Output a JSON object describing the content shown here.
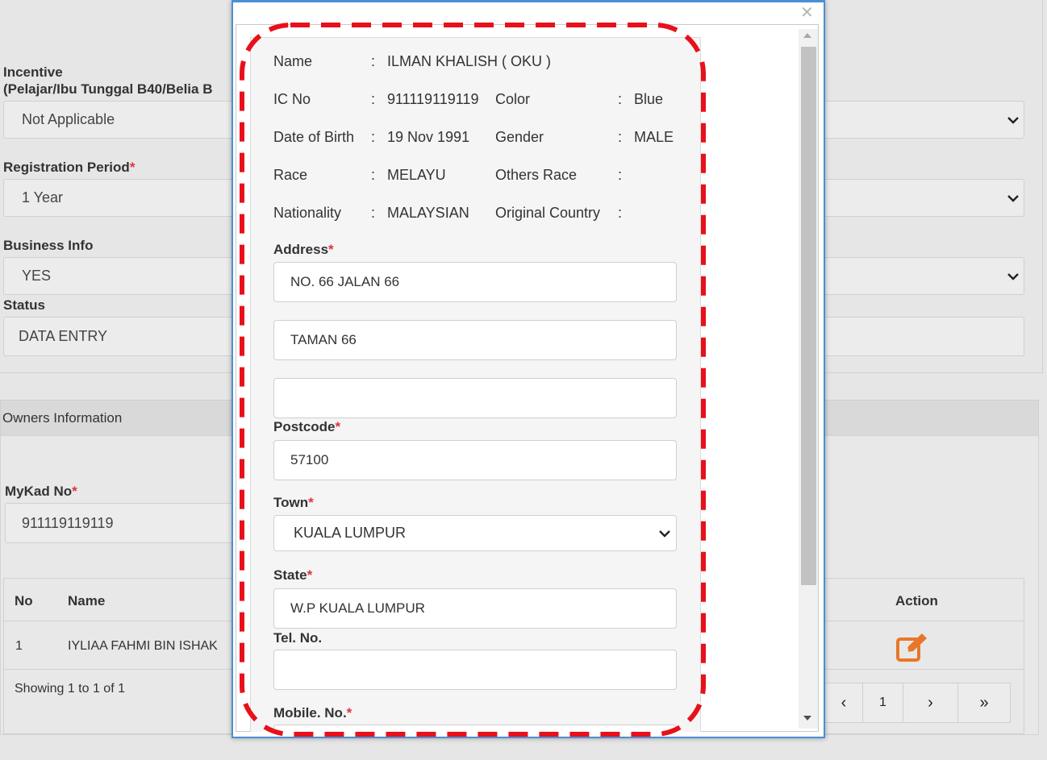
{
  "background": {
    "incentive_label": "Incentive",
    "incentive_sublabel": "(Pelajar/Ibu Tunggal B40/Belia B",
    "incentive_value": "Not Applicable",
    "registration_period_label": "Registration Period",
    "registration_period_value": "1 Year",
    "business_info_label": "Business Info",
    "business_info_value": "YES",
    "status_label": "Status",
    "status_value": "DATA ENTRY",
    "owners_header": "Owners Information",
    "mykad_label": "MyKad No",
    "mykad_value": "911119119119",
    "table": {
      "col_no": "No",
      "col_name": "Name",
      "col_action": "Action",
      "row_no": "1",
      "row_name": "IYLIAA FAHMI BIN ISHAK",
      "showing": "Showing 1 to 1 of 1"
    },
    "pager": {
      "prev": "‹",
      "page": "1",
      "next": "›",
      "last": "»"
    },
    "required_mark": "*"
  },
  "modal": {
    "close": "✕",
    "info": {
      "name_label": "Name",
      "name_value": "ILMAN KHALISH ( OKU )",
      "ic_label": "IC No",
      "ic_value": "911119119119",
      "color_label": "Color",
      "color_value": "Blue",
      "dob_label": "Date of Birth",
      "dob_value": "19 Nov 1991",
      "gender_label": "Gender",
      "gender_value": "MALE",
      "race_label": "Race",
      "race_value": "MELAYU",
      "others_race_label": "Others Race",
      "others_race_value": "",
      "nationality_label": "Nationality",
      "nationality_value": "MALAYSIAN",
      "original_country_label": "Original Country",
      "original_country_value": "",
      "colon": ":"
    },
    "form": {
      "address_label": "Address",
      "address_line1": "NO. 66 JALAN 66",
      "address_line2": "TAMAN 66",
      "address_line3": "",
      "postcode_label": "Postcode",
      "postcode_value": "57100",
      "town_label": "Town",
      "town_value": "KUALA LUMPUR",
      "state_label": "State",
      "state_value": "W.P KUALA LUMPUR",
      "tel_label": "Tel. No.",
      "tel_value": "",
      "mobile_label": "Mobile. No."
    }
  },
  "colors": {
    "highlight": "#e8101a",
    "required": "#e0333a",
    "edit_icon": "#e8772a",
    "modal_border": "#4a8fd6"
  }
}
